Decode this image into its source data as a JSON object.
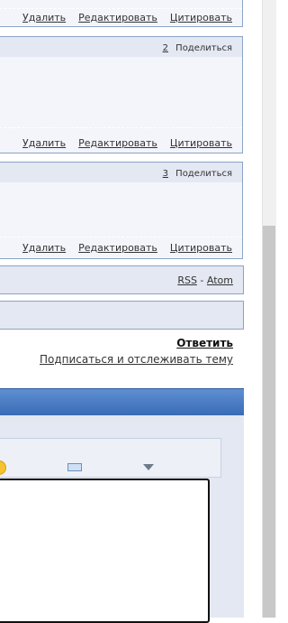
{
  "posts": [
    {
      "actions": [
        "Удалить",
        "Редактировать",
        "Цитировать"
      ]
    },
    {
      "number": "2",
      "share": "Поделиться",
      "actions": [
        "Удалить",
        "Редактировать",
        "Цитировать"
      ]
    },
    {
      "number": "3",
      "share": "Поделиться",
      "actions": [
        "Удалить",
        "Редактировать",
        "Цитировать"
      ]
    }
  ],
  "feeds": {
    "rss": "RSS",
    "sep": "-",
    "atom": "Atom"
  },
  "reply": {
    "label": "Ответить"
  },
  "subscribe": {
    "label": "Подписаться и отслеживать тему"
  },
  "editor": {
    "icons": [
      "smiley-icon",
      "keyboard-icon",
      "dropdown-arrow-icon"
    ]
  },
  "colors": {
    "border": "#8aa4c6",
    "header_bg": "#e3e8f2",
    "editor_bar": "#3a6cb6"
  }
}
